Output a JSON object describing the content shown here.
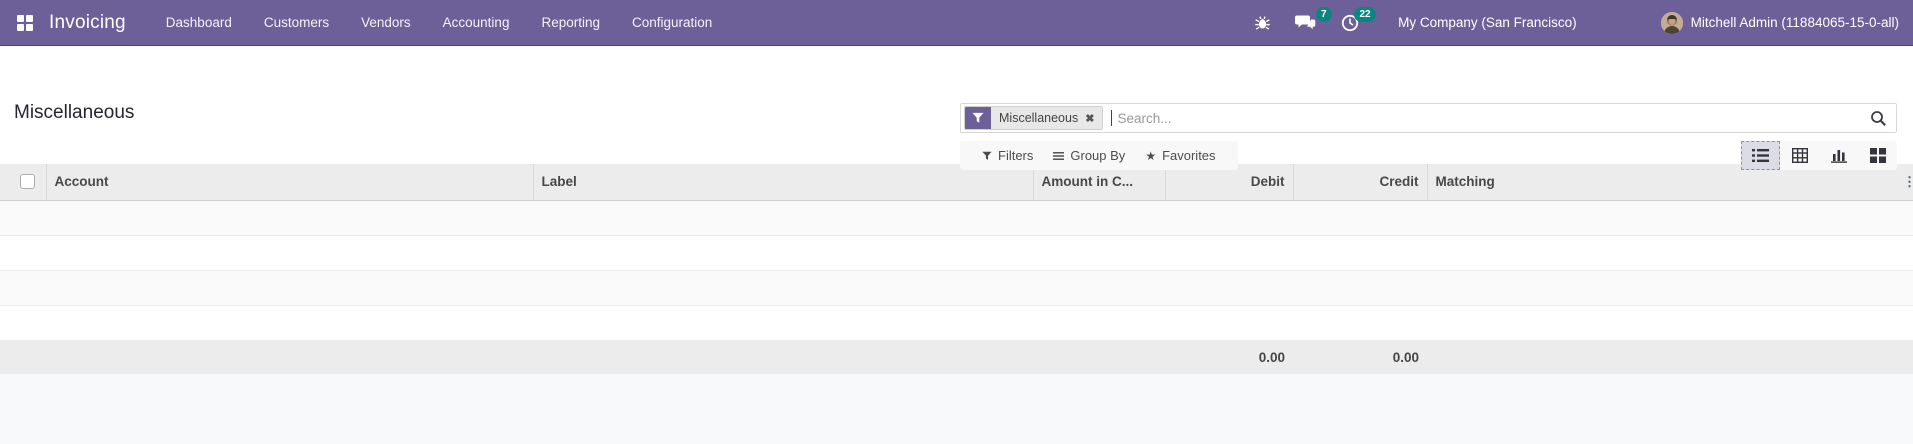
{
  "app": {
    "name": "Invoicing"
  },
  "nav": {
    "items": [
      {
        "label": "Dashboard"
      },
      {
        "label": "Customers"
      },
      {
        "label": "Vendors"
      },
      {
        "label": "Accounting"
      },
      {
        "label": "Reporting"
      },
      {
        "label": "Configuration"
      }
    ]
  },
  "systray": {
    "messages_count": "7",
    "activities_count": "22",
    "company": "My Company (San Francisco)",
    "user": "Mitchell Admin (11884065-15-0-all)"
  },
  "page": {
    "title": "Miscellaneous"
  },
  "search": {
    "facet_label": "Miscellaneous",
    "facet_remove": "✖",
    "placeholder": "Search...",
    "filters_label": "Filters",
    "group_by_label": "Group By",
    "favorites_label": "Favorites",
    "favorites_icon": "★"
  },
  "table": {
    "columns": {
      "account": "Account",
      "label": "Label",
      "amount_currency": "Amount in C...",
      "debit": "Debit",
      "credit": "Credit",
      "matching": "Matching"
    },
    "options_toggle_icon": "⋮",
    "rows": [],
    "totals": {
      "debit": "0.00",
      "credit": "0.00"
    }
  },
  "colors": {
    "navbar": "#6d6098",
    "badge": "#0a8583",
    "header_bg": "#ececec",
    "stripe": "#fafafa",
    "bottom_bg": "#f8f9fa"
  }
}
